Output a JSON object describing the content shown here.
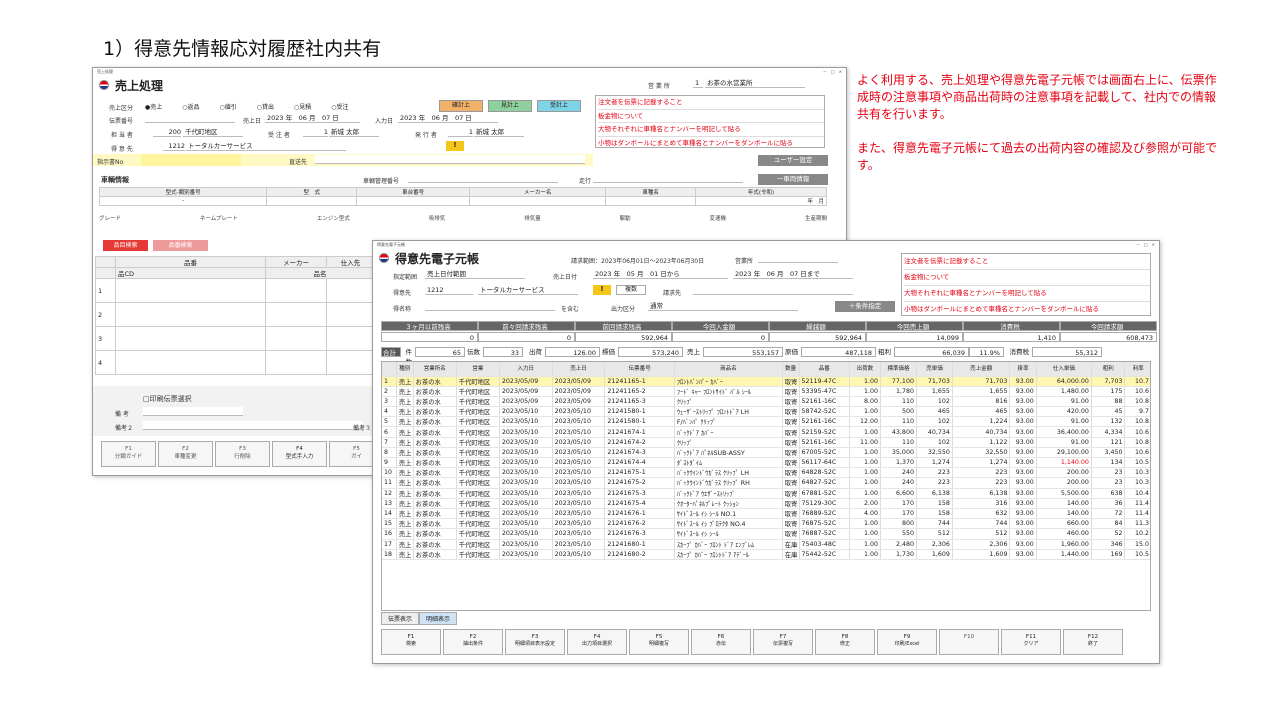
{
  "page_title": "1）得意先情報応対履歴社内共有",
  "notes": [
    "よく利用する、売上処理や得意先電子元帳では画面右上に、伝票作成時の注意事項や商品出荷時の注意事項を記載して、社内での情報共有を行います。",
    "また、得意先電子元帳にて過去の出荷内容の確認及び参照が可能です。"
  ],
  "win1": {
    "titlebar": "売上処理",
    "winctl": "－　□　×",
    "title": "売上処理",
    "office_label": "営 業 所",
    "office_no": "1",
    "office_name": "お茶の水営業所",
    "kubun_label": "売上区分",
    "radios": [
      "●売上",
      "○返品",
      "○値引",
      "○貸出",
      "○見積",
      "○受注"
    ],
    "btn_kakutei": "確計上",
    "btn_mitsumori": "見計上",
    "btn_juchu": "受計上",
    "denpyo_label": "伝票番号",
    "uriagebi_label": "売上日",
    "uriagebi": "2023 年　06 月　07 日",
    "nyuryokubi_label": "入力日",
    "nyuryokubi": "2023 年　06 月　07 日",
    "tanto_label": "担 当 者",
    "tanto_code": "200",
    "tanto_name": "千代町地区",
    "juchu_label": "受 注 者",
    "juchu_code": "1",
    "juchu_name": "新城 太郎",
    "hakko_label": "発 行 者",
    "hakko_code": "1",
    "hakko_name": "新城 太郎",
    "tokui_label": "得 意 先",
    "tokui_code": "1212",
    "tokui_name": "トータルカーサービス",
    "warn": "!",
    "shiji_label": "指示書No",
    "nohin_label": "直送先",
    "user_btn": "ユーザー設定",
    "memo": [
      "注文者を伝票に記載すること",
      "板金物について",
      "大物それぞれに車種名とナンバーを明記して貼る",
      "小物はダンボールにまとめて車種名とナンバーをダンボールに貼る"
    ],
    "sharyo_label": "車輌情報",
    "kanri_label": "車輌管理番号",
    "soko_label": "走行",
    "ichiran_btn": "一車両情報",
    "car_heads": [
      "型式-類別番号",
      "型　式",
      "車台番号",
      "メーカー名",
      "車種名",
      "年式(令和)"
    ],
    "car_vals": [
      "-",
      "",
      "",
      "",
      "",
      "年　月"
    ],
    "car2_heads": [
      "グレード",
      "ネームプレート",
      "エンジン型式",
      "吸排気",
      "排気量",
      "駆動",
      "変速機",
      "生産期間"
    ],
    "hinmoku_btn": "品目検索",
    "hinban_btn": "品番検索",
    "grid_heads": [
      "",
      "品番",
      "メーカー",
      "仕入先"
    ],
    "grid_sub": [
      "品CD",
      "品名"
    ],
    "rows": [
      "1",
      "2",
      "3",
      "4"
    ],
    "print_label": "□印刷伝票選択",
    "biko1": "備 考",
    "biko2": "備考２",
    "biko3": "備考３",
    "fkeys": [
      [
        "F1",
        "分類ガイド"
      ],
      [
        "F2",
        "車種変更"
      ],
      [
        "F3",
        "行削除"
      ],
      [
        "F4",
        "型式手入力"
      ],
      [
        "F5",
        "ガイ"
      ]
    ]
  },
  "win2": {
    "titlebar": "得意先電子元帳",
    "winctl": "－　□　×",
    "title": "得意先電子元帳",
    "range": "請求範囲：2023年06月01日〜2023年06月30日",
    "office_label": "営業所",
    "shitei_label": "指定範囲",
    "shitei_val": "売上日付範囲",
    "uriagebi_label": "売上日付",
    "from": "2023 年　05 月　01 日から",
    "to": "2023 年　06 月　07 日まで",
    "tokui_label": "得意先",
    "tokui_code": "1212",
    "tokui_name": "トータルカーサービス",
    "warn": "!",
    "fukusu": "複数",
    "seikyu_label": "請求先",
    "hinmei_label": "得名称",
    "fukumu": "を含む",
    "shutsuryoku_label": "出力区分",
    "shutsuryoku": "通常",
    "joken_btn": "＋条件指定",
    "memo": [
      "注文者を伝票に記載すること",
      "板金物について",
      "大物それぞれに車種名とナンバーを明記して貼る",
      "小物はダンボールにまとめて車種名とナンバーをダンボールに貼る"
    ],
    "sum_heads": [
      "３ヶ月以前残高",
      "前々回請求残高",
      "前回請求残高",
      "今回入金額",
      "繰越額",
      "今回売上額",
      "消費税",
      "今回請求額"
    ],
    "sum_vals": [
      "0",
      "0",
      "592,964",
      "0",
      "592,964",
      "14,099",
      "1,410",
      "608,473"
    ],
    "tot": [
      [
        "合計",
        ""
      ],
      [
        "件数",
        "65"
      ],
      [
        "伝数",
        "33"
      ],
      [
        "出荷",
        "126.00"
      ],
      [
        "標価",
        "573,240"
      ],
      [
        "売上",
        "553,157"
      ],
      [
        "原価",
        "487,118"
      ],
      [
        "粗利",
        "66,039"
      ],
      [
        "",
        "11.9%"
      ],
      [
        "消費税",
        "55,312"
      ]
    ],
    "cols": [
      "",
      "種別",
      "営業所名",
      "配達",
      "営業",
      "赤伝",
      "入力日",
      "売上日",
      "伝票番号",
      "商品名",
      "数量",
      "品番",
      "計上単価",
      "出荷数",
      "標準価格",
      "売単価",
      "売上金額",
      "掛率",
      "仕入単価",
      "粗利",
      "利率",
      ""
    ],
    "rows": [
      [
        "1",
        "売上",
        "お茶の水",
        "千代町地区",
        "2023/05/09",
        "2023/05/09",
        "21241165-1",
        "ﾌﾛﾝﾄﾊﾞﾝﾊﾟｰ ｶﾊﾞｰ",
        "取寄",
        "52119-47C",
        "1.00",
        "77,100",
        "71,703",
        "71,703",
        "93.00",
        "64,000.00",
        "7,703",
        "10.7"
      ],
      [
        "2",
        "売上",
        "お茶の水",
        "千代町地区",
        "2023/05/09",
        "2023/05/09",
        "21241165-2",
        "ﾌｰﾄﾞ ｷｬｰ ﾌﾛﾝﾄｻｲﾄﾞ ﾊﾞﾙ ｼｰﾙ",
        "取寄",
        "53395-47C",
        "1.00",
        "1,780",
        "1,655",
        "1,655",
        "93.00",
        "1,480.00",
        "175",
        "10.6"
      ],
      [
        "3",
        "売上",
        "お茶の水",
        "千代町地区",
        "2023/05/09",
        "2023/05/09",
        "21241165-3",
        "ｸﾘｯﾌﾟ",
        "取寄",
        "52161-16C",
        "8.00",
        "110",
        "102",
        "816",
        "93.00",
        "91.00",
        "88",
        "10.8"
      ],
      [
        "4",
        "売上",
        "お茶の水",
        "千代町地区",
        "2023/05/10",
        "2023/05/10",
        "21241580-1",
        "ｳｪｰｻﾞｰｽﾄﾘｯﾌﾟ ﾌﾛﾝﾄﾄﾞｱ LH",
        "取寄",
        "58742-52C",
        "1.00",
        "500",
        "465",
        "465",
        "93.00",
        "420.00",
        "45",
        "9.7"
      ],
      [
        "5",
        "売上",
        "お茶の水",
        "千代町地区",
        "2023/05/10",
        "2023/05/10",
        "21241580-1",
        "F/ﾊﾞﾝﾊﾟ ｸﾘｯﾌﾟ",
        "取寄",
        "52161-16C",
        "12.00",
        "110",
        "102",
        "1,224",
        "93.00",
        "91.00",
        "132",
        "10.8"
      ],
      [
        "6",
        "売上",
        "お茶の水",
        "千代町地区",
        "2023/05/10",
        "2023/05/10",
        "21241674-1",
        "ﾊﾞｯｸﾄﾞｱ ｶﾊﾞｰ",
        "取寄",
        "52159-52C",
        "1.00",
        "43,800",
        "40,734",
        "40,734",
        "93.00",
        "36,400.00",
        "4,334",
        "10.6"
      ],
      [
        "7",
        "売上",
        "お茶の水",
        "千代町地区",
        "2023/05/10",
        "2023/05/10",
        "21241674-2",
        "ｸﾘｯﾌﾟ",
        "取寄",
        "52161-16C",
        "11.00",
        "110",
        "102",
        "1,122",
        "93.00",
        "91.00",
        "121",
        "10.8"
      ],
      [
        "8",
        "売上",
        "お茶の水",
        "千代町地区",
        "2023/05/10",
        "2023/05/10",
        "21241674-3",
        "ﾊﾞｯｸﾄﾞｱ ﾊﾟﾈﾙSUB-ASSY",
        "取寄",
        "67005-52C",
        "1.00",
        "35,000",
        "32,550",
        "32,550",
        "93.00",
        "29,100.00",
        "3,450",
        "10.6"
      ],
      [
        "9",
        "売上",
        "お茶の水",
        "千代町地区",
        "2023/05/10",
        "2023/05/10",
        "21241674-4",
        "ﾀﾞｽﾄﾀﾞｲﾑ",
        "取寄",
        "56117-64C",
        "1.00",
        "1,370",
        "1,274",
        "1,274",
        "93.00",
        "1,140.00",
        "134",
        "10.5"
      ],
      [
        "10",
        "売上",
        "お茶の水",
        "千代町地区",
        "2023/05/10",
        "2023/05/10",
        "21241675-1",
        "ﾊﾞｯｸｳｲﾝﾄﾞｳｶﾞﾗｽ ｸﾘｯﾌﾟ LH",
        "取寄",
        "64828-52C",
        "1.00",
        "240",
        "223",
        "223",
        "93.00",
        "200.00",
        "23",
        "10.3"
      ],
      [
        "11",
        "売上",
        "お茶の水",
        "千代町地区",
        "2023/05/10",
        "2023/05/10",
        "21241675-2",
        "ﾊﾞｯｸｳｲﾝﾄﾞｳｶﾞﾗｽ ｸﾘｯﾌﾟ RH",
        "取寄",
        "64827-52C",
        "1.00",
        "240",
        "223",
        "223",
        "93.00",
        "200.00",
        "23",
        "10.3"
      ],
      [
        "12",
        "売上",
        "お茶の水",
        "千代町地区",
        "2023/05/10",
        "2023/05/10",
        "21241675-3",
        "ﾊﾞｯｸﾄﾞｱ ｳｴｻﾞｰｽﾄﾘｯﾌﾟ",
        "取寄",
        "67881-52C",
        "1.00",
        "6,600",
        "6,138",
        "6,138",
        "93.00",
        "5,500.00",
        "638",
        "10.4"
      ],
      [
        "13",
        "売上",
        "お茶の水",
        "千代町地区",
        "2023/05/10",
        "2023/05/10",
        "21241675-4",
        "ｸｵｰﾀｰﾊﾟﾈﾙﾌﾟﾚｰﾄ ｸｯｼｮﾝ",
        "取寄",
        "75129-30C",
        "2.00",
        "170",
        "158",
        "316",
        "93.00",
        "140.00",
        "36",
        "11.4"
      ],
      [
        "14",
        "売上",
        "お茶の水",
        "千代町地区",
        "2023/05/10",
        "2023/05/10",
        "21241676-1",
        "ｻｲﾄﾞｽｰﾙ ｲｼ ｼｰﾙ NO.1",
        "取寄",
        "76889-52C",
        "4.00",
        "170",
        "158",
        "632",
        "93.00",
        "140.00",
        "72",
        "11.4"
      ],
      [
        "15",
        "売上",
        "お茶の水",
        "千代町地区",
        "2023/05/10",
        "2023/05/10",
        "21241676-2",
        "ｻｲﾄﾞｽｰﾙ ｲｼ ﾌﾟﾛﾃｸﾀ NO.4",
        "取寄",
        "76875-52C",
        "1.00",
        "800",
        "744",
        "744",
        "93.00",
        "660.00",
        "84",
        "11.3"
      ],
      [
        "16",
        "売上",
        "お茶の水",
        "千代町地区",
        "2023/05/10",
        "2023/05/10",
        "21241676-3",
        "ｻｲﾄﾞｽｰﾙ ｲｼ ｼｰﾙ",
        "取寄",
        "76887-52C",
        "1.00",
        "550",
        "512",
        "512",
        "93.00",
        "460.00",
        "52",
        "10.2"
      ],
      [
        "17",
        "売上",
        "お茶の水",
        "千代町地区",
        "2023/05/10",
        "2023/05/10",
        "21241680-1",
        "ｽｶｰﾌﾟ ｶﾊﾞｰ ﾌﾛﾝﾄ ﾄﾞｱ ｴﾝﾌﾞﾚﾑ",
        "在庫",
        "75403-48C",
        "1.00",
        "2,480",
        "2,306",
        "2,306",
        "93.00",
        "1,960.00",
        "346",
        "15.0"
      ],
      [
        "18",
        "売上",
        "お茶の水",
        "千代町地区",
        "2023/05/10",
        "2023/05/10",
        "21241680-2",
        "ｽｶｰﾌﾟ ｶﾊﾞｰ ﾌﾛﾝﾄﾄﾞｱ ｱﾃﾞｰﾙ",
        "在庫",
        "75442-52C",
        "1.00",
        "1,730",
        "1,609",
        "1,609",
        "93.00",
        "1,440.00",
        "169",
        "10.5"
      ]
    ],
    "tabs": [
      "伝票表示",
      "明細表示"
    ],
    "fkeys": [
      [
        "F1",
        "検索"
      ],
      [
        "F2",
        "抽出条件"
      ],
      [
        "F3",
        "明細項目表示設定"
      ],
      [
        "F4",
        "出力項目選択"
      ],
      [
        "F5",
        "明細複写"
      ],
      [
        "F6",
        "赤伝"
      ],
      [
        "F7",
        "伝票複写"
      ],
      [
        "F8",
        "修正"
      ],
      [
        "F9",
        "印刷/Excel"
      ],
      [
        "F10",
        ""
      ],
      [
        "F11",
        "クリア"
      ],
      [
        "F12",
        "終了"
      ]
    ]
  },
  "colors": {
    "accent_red": "#e60012",
    "yellow_btn": "#f2c94c",
    "green_btn": "#8fd19e",
    "cyan_btn": "#7fd3e6"
  }
}
